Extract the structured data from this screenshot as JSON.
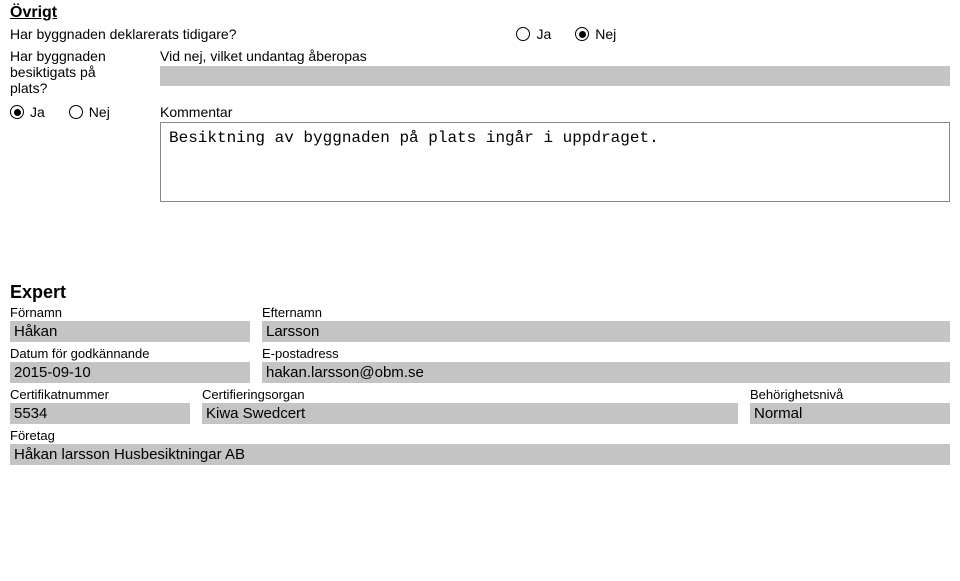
{
  "ovrigt": {
    "title": "Övrigt",
    "q1_label": "Har byggnaden deklarerats tidigare?",
    "ja": "Ja",
    "nej": "Nej",
    "q2_label": "Har byggnaden besiktigats på plats?",
    "undantag_label": "Vid nej, vilket undantag åberopas",
    "undantag_value": "",
    "kommentar_label": "Kommentar",
    "kommentar_value": "Besiktning av byggnaden på plats ingår i uppdraget."
  },
  "expert": {
    "title": "Expert",
    "fornamn_label": "Förnamn",
    "fornamn_value": "Håkan",
    "efternamn_label": "Efternamn",
    "efternamn_value": "Larsson",
    "datum_label": "Datum för godkännande",
    "datum_value": "2015-09-10",
    "epost_label": "E-postadress",
    "epost_value": "hakan.larsson@obm.se",
    "certnr_label": "Certifikatnummer",
    "certnr_value": "5534",
    "organ_label": "Certifieringsorgan",
    "organ_value": "Kiwa Swedcert",
    "beh_label": "Behörighetsnivå",
    "beh_value": "Normal",
    "foretag_label": "Företag",
    "foretag_value": "Håkan larsson Husbesiktningar AB"
  }
}
